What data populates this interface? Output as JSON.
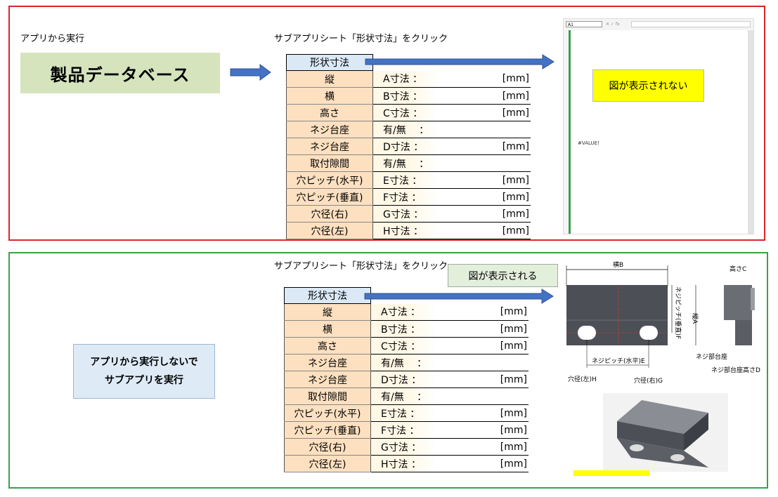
{
  "top": {
    "left_caption": "アプリから実行",
    "db_label": "製品データベース",
    "sub_caption": "サブアプリシート「形状寸法」をクリック",
    "table_header": "形状寸法",
    "excel_namebox": "A1",
    "excel_fx": "✕ ✓ fx",
    "excel_error": "#VALUE!",
    "note": "図が表示されない"
  },
  "bottom": {
    "sub_caption": "サブアプリシート「形状寸法」をクリック",
    "note": "図が表示される",
    "action_line1": "アプリから実行しないで",
    "action_line2": "サブアプリを実行",
    "table_header": "形状寸法",
    "drawing": {
      "width_label": "横B",
      "height_label": "高さC",
      "vertical_label": "縦A",
      "pitch_v_label": "ネジピッチ(垂直)F",
      "pitch_h_label": "ネジピッチ(水平)E",
      "hole_left_label": "穴径(左)H",
      "hole_right_label": "穴径(右)G",
      "seat_label": "ネジ部台座",
      "seat_height_label": "ネジ部台座高さD"
    }
  },
  "rows": [
    {
      "label": "縦",
      "dim": "A寸法 ：",
      "value": "",
      "unit": "[mm]"
    },
    {
      "label": "横",
      "dim": "B寸法 ：",
      "value": "",
      "unit": "[mm]"
    },
    {
      "label": "高さ",
      "dim": "C寸法 ：",
      "value": "",
      "unit": "[mm]"
    },
    {
      "label": "ネジ台座",
      "dim": "有/無 　：",
      "value": "",
      "unit": ""
    },
    {
      "label": "ネジ台座",
      "dim": "D寸法 ：",
      "value": "",
      "unit": "[mm]"
    },
    {
      "label": "取付隙間",
      "dim": "有/無 　：",
      "value": "",
      "unit": ""
    },
    {
      "label": "穴ピッチ(水平)",
      "dim": "E寸法 ：",
      "value": "",
      "unit": "[mm]"
    },
    {
      "label": "穴ピッチ(垂直)",
      "dim": "F寸法 ：",
      "value": "",
      "unit": "[mm]"
    },
    {
      "label": "穴径(右)",
      "dim": "G寸法 ：",
      "value": "",
      "unit": "[mm]"
    },
    {
      "label": "穴径(左)",
      "dim": "H寸法 ：",
      "value": "",
      "unit": "[mm]"
    }
  ],
  "colors": {
    "top_border": "#d9262b",
    "bottom_border": "#3aa04a",
    "arrow": "#4472c4",
    "db_box": "#d6e4bd",
    "yellow": "#ffff00",
    "label_cell": "#fde0c0",
    "header_cell": "#dbe9f6"
  }
}
